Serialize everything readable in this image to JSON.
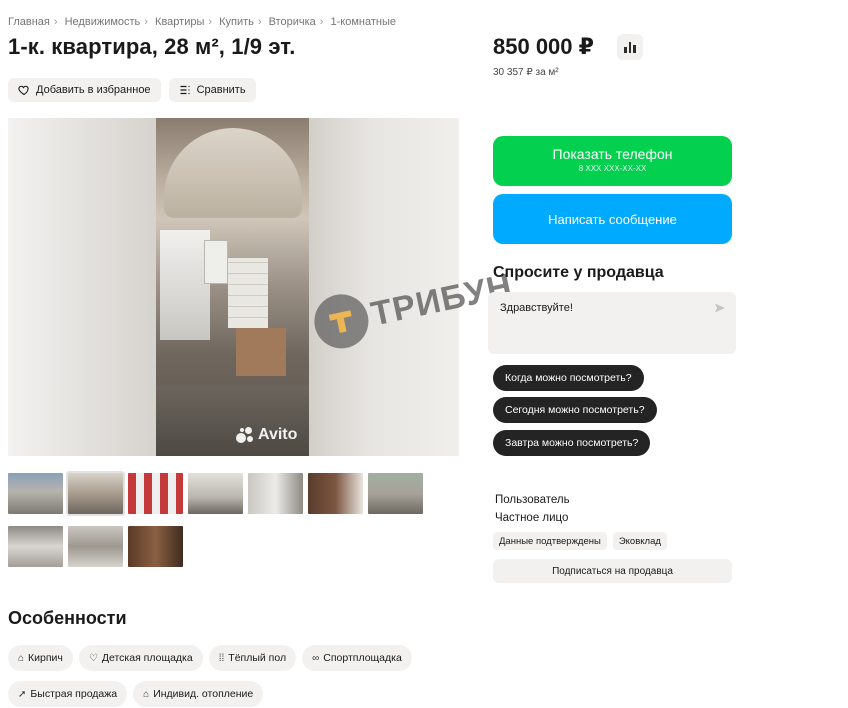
{
  "breadcrumb": [
    "Главная",
    "Недвижимость",
    "Квартиры",
    "Купить",
    "Вторичка",
    "1-комнатные"
  ],
  "breadcrumb_separator": "›",
  "title": "1-к. квартира, 28 м², 1/9 эт.",
  "actions": {
    "favorite_label": "Добавить в избранное",
    "compare_label": "Сравнить"
  },
  "gallery": {
    "photo_watermark": "Avito",
    "overlay_watermark": "ТРИБУН",
    "thumbnail_count": 10,
    "active_thumbnail": 2
  },
  "price": {
    "value": "850 000 ₽",
    "per_meter": "30 357 ₽ за м²"
  },
  "contact": {
    "phone_button": "Показать телефон",
    "phone_masked": "8 XXX XXX-XX-XX",
    "message_button": "Написать сообщение"
  },
  "ask": {
    "title": "Спросите у продавца",
    "input_value": "Здравствуйте!",
    "quick_questions": [
      "Когда можно посмотреть?",
      "Сегодня можно посмотреть?",
      "Завтра можно посмотреть?"
    ]
  },
  "seller": {
    "name": "Пользователь",
    "type": "Частное лицо",
    "badges": [
      "Данные подтверждены",
      "Эковклад"
    ],
    "subscribe_label": "Подписаться на продавца"
  },
  "features": {
    "title": "Особенности",
    "items": [
      {
        "label": "Кирпич",
        "icon": "house-icon"
      },
      {
        "label": "Детская площадка",
        "icon": "playground-icon"
      },
      {
        "label": "Тёплый пол",
        "icon": "heated-floor-icon"
      },
      {
        "label": "Спортплощадка",
        "icon": "dumbbell-icon"
      },
      {
        "label": "Быстрая продажа",
        "icon": "rocket-icon"
      },
      {
        "label": "Индивид. отопление",
        "icon": "heating-icon"
      }
    ]
  },
  "colors": {
    "phone_button": "#04d04f",
    "message_button": "#00aaff",
    "quick_chip": "#242424",
    "chip_bg": "#f2f1f0"
  }
}
